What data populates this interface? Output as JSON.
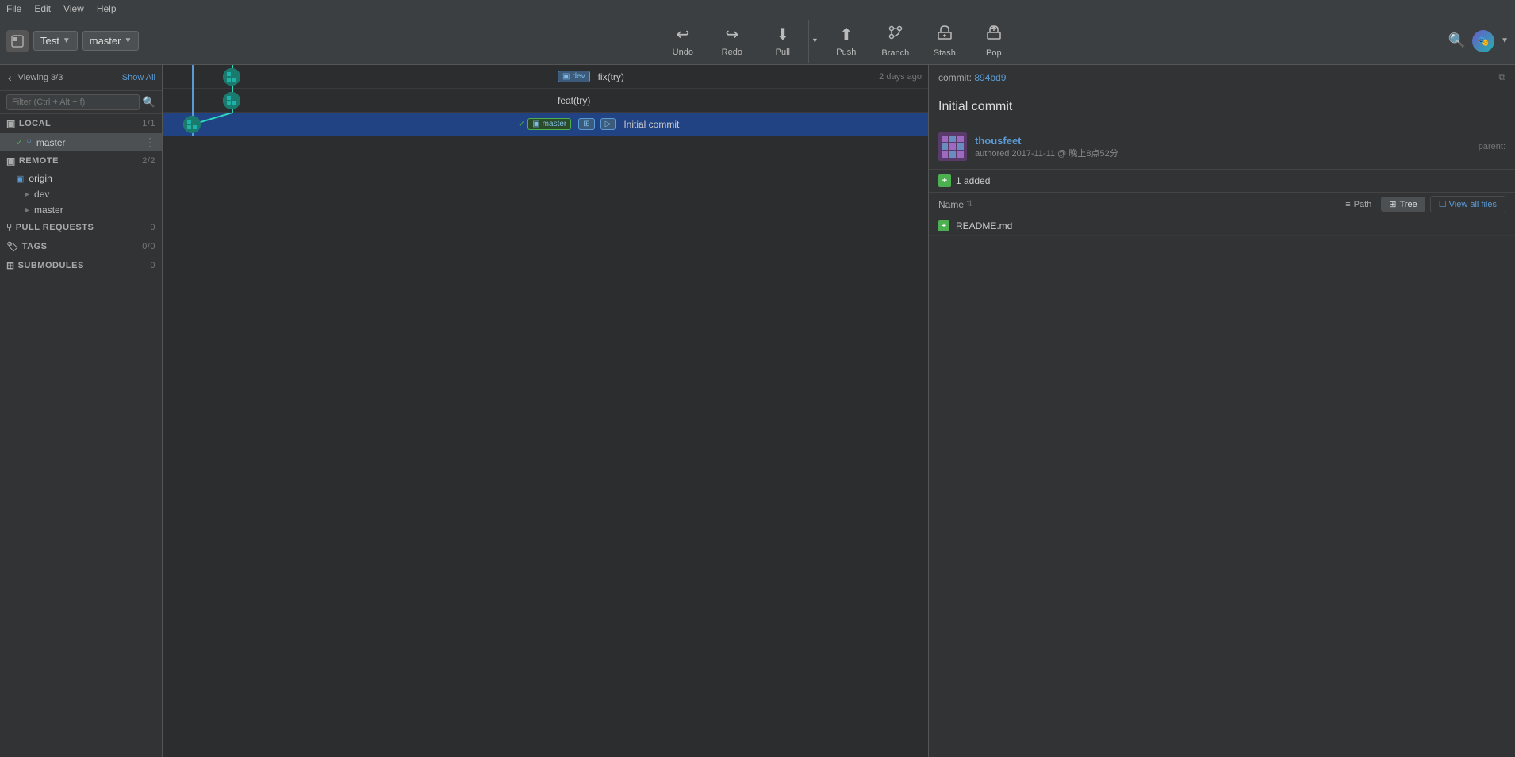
{
  "menubar": {
    "items": [
      "File",
      "Edit",
      "View",
      "Help"
    ]
  },
  "toolbar": {
    "repo_name": "Test",
    "branch_name": "master",
    "buttons": [
      {
        "id": "undo",
        "label": "Undo",
        "icon": "↩"
      },
      {
        "id": "redo",
        "label": "Redo",
        "icon": "↪"
      },
      {
        "id": "pull",
        "label": "Pull",
        "icon": "⬇"
      },
      {
        "id": "push",
        "label": "Push",
        "icon": "⬆"
      },
      {
        "id": "branch",
        "label": "Branch",
        "icon": "⑂"
      },
      {
        "id": "stash",
        "label": "Stash",
        "icon": "📥"
      },
      {
        "id": "pop",
        "label": "Pop",
        "icon": "📤"
      }
    ]
  },
  "sidebar": {
    "back_icon": "‹",
    "viewing_label": "Viewing 3/3",
    "show_all": "Show All",
    "filter_placeholder": "Filter (Ctrl + Alt + f)",
    "local": {
      "label": "LOCAL",
      "count": "1/1",
      "branches": [
        {
          "name": "master",
          "active": true,
          "checked": true
        }
      ]
    },
    "remote": {
      "label": "REMOTE",
      "count": "2/2",
      "origins": [
        {
          "name": "origin",
          "children": [
            "dev",
            "master"
          ]
        }
      ]
    },
    "pull_requests": {
      "label": "PULL REQUESTS",
      "count": "0"
    },
    "tags": {
      "label": "TAGS",
      "count": "0/0"
    },
    "submodules": {
      "label": "SUBMODULES",
      "count": "0"
    }
  },
  "commits": [
    {
      "id": 1,
      "branch_tags": [
        "dev"
      ],
      "message": "fix(try)",
      "timestamp": "2 days ago",
      "avatar": "teal",
      "selected": false
    },
    {
      "id": 2,
      "branch_tags": [],
      "message": "feat(try)",
      "timestamp": "",
      "avatar": "teal",
      "selected": false
    },
    {
      "id": 3,
      "branch_tags": [
        "master"
      ],
      "message": "Initial commit",
      "timestamp": "",
      "avatar": "teal",
      "selected": true
    }
  ],
  "right_panel": {
    "commit_label": "commit:",
    "commit_id": "894bd9",
    "title": "Initial commit",
    "author": {
      "name": "thousfeet",
      "date": "authored 2017-11-11 @ 晚上8点52分",
      "pixel_colors": [
        "#9c6bbf",
        "#6a8dbf"
      ]
    },
    "parent_label": "parent:",
    "parent_value": "",
    "added_count": "1 added",
    "file_list": {
      "name_col": "Name",
      "sort_icon": "⇅",
      "path_tab": "Path",
      "tree_tab": "Tree",
      "view_all": "View all files",
      "files": [
        {
          "name": "README.md",
          "status": "added"
        }
      ]
    }
  }
}
